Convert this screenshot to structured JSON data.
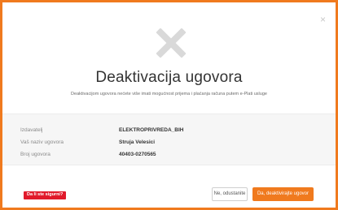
{
  "dialog": {
    "close_glyph": "×",
    "title": "Deaktivacija ugovora",
    "subtitle": "Deaktivacijom ugovora nećete više imati mogućnost prijema i plaćanja računa putem e-Plati usluge"
  },
  "details": {
    "rows": [
      {
        "label": "Izdavatelj",
        "value": "ELEKTROPRIVREDA_BIH"
      },
      {
        "label": "Vaš naziv ugovora",
        "value": "Struja Velesici"
      },
      {
        "label": "Broj ugovora",
        "value": "40403-0270565"
      }
    ]
  },
  "warning": {
    "text": "Da li ste sigurni?"
  },
  "actions": {
    "cancel_label": "Ne, odustanite",
    "confirm_label": "Da, deaktivirajte ugovor"
  },
  "colors": {
    "accent": "#f07a1e",
    "warning": "#e11a2b",
    "icon_gray": "#d9d9d9"
  },
  "icons": {
    "close": "close-icon",
    "header": "x-mark-icon"
  }
}
